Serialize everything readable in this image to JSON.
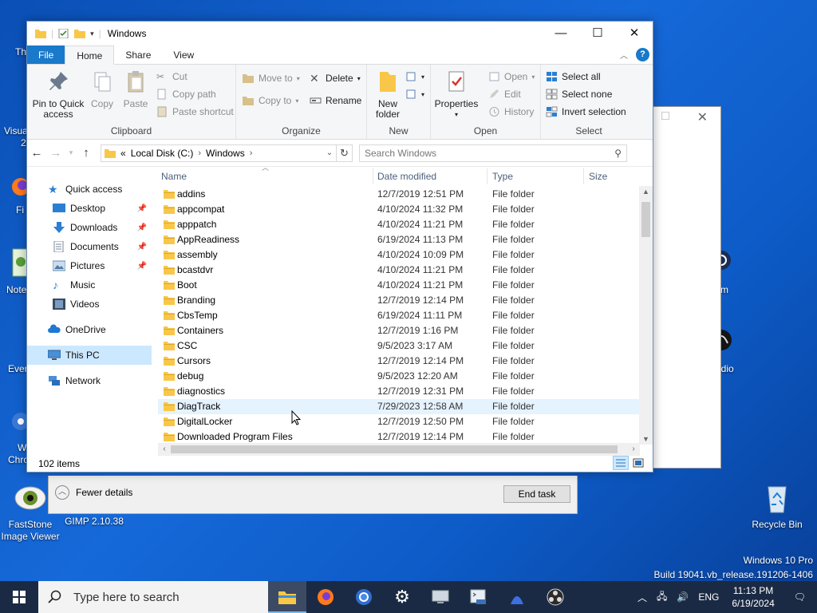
{
  "explorer": {
    "title": "Windows",
    "window_buttons": {
      "minimize": "—",
      "maximize": "☐",
      "close": "✕"
    },
    "tabs": [
      {
        "label": "File"
      },
      {
        "label": "Home"
      },
      {
        "label": "Share"
      },
      {
        "label": "View"
      }
    ],
    "ribbon": {
      "clipboard": {
        "group_label": "Clipboard",
        "pin": "Pin to Quick access",
        "copy": "Copy",
        "paste": "Paste",
        "cut": "Cut",
        "copy_path": "Copy path",
        "paste_shortcut": "Paste shortcut"
      },
      "organize": {
        "group_label": "Organize",
        "move_to": "Move to",
        "copy_to": "Copy to",
        "delete": "Delete",
        "rename": "Rename"
      },
      "new": {
        "group_label": "New",
        "new_folder": "New folder"
      },
      "open": {
        "group_label": "Open",
        "properties": "Properties",
        "open": "Open",
        "edit": "Edit",
        "history": "History"
      },
      "select": {
        "group_label": "Select",
        "select_all": "Select all",
        "select_none": "Select none",
        "invert": "Invert selection"
      }
    },
    "address": {
      "prefix": "«",
      "crumbs": [
        "Local Disk (C:)",
        "Windows"
      ],
      "search_placeholder": "Search Windows"
    },
    "nav": {
      "quick_access": "Quick access",
      "desktop": "Desktop",
      "downloads": "Downloads",
      "documents": "Documents",
      "pictures": "Pictures",
      "music": "Music",
      "videos": "Videos",
      "onedrive": "OneDrive",
      "this_pc": "This PC",
      "network": "Network"
    },
    "columns": {
      "name": "Name",
      "date": "Date modified",
      "type": "Type",
      "size": "Size"
    },
    "files": [
      {
        "name": "addins",
        "date": "12/7/2019 12:51 PM",
        "type": "File folder"
      },
      {
        "name": "appcompat",
        "date": "4/10/2024 11:32 PM",
        "type": "File folder"
      },
      {
        "name": "apppatch",
        "date": "4/10/2024 11:21 PM",
        "type": "File folder"
      },
      {
        "name": "AppReadiness",
        "date": "6/19/2024 11:13 PM",
        "type": "File folder"
      },
      {
        "name": "assembly",
        "date": "4/10/2024 10:09 PM",
        "type": "File folder"
      },
      {
        "name": "bcastdvr",
        "date": "4/10/2024 11:21 PM",
        "type": "File folder"
      },
      {
        "name": "Boot",
        "date": "4/10/2024 11:21 PM",
        "type": "File folder"
      },
      {
        "name": "Branding",
        "date": "12/7/2019 12:14 PM",
        "type": "File folder"
      },
      {
        "name": "CbsTemp",
        "date": "6/19/2024 11:11 PM",
        "type": "File folder"
      },
      {
        "name": "Containers",
        "date": "12/7/2019 1:16 PM",
        "type": "File folder"
      },
      {
        "name": "CSC",
        "date": "9/5/2023 3:17 AM",
        "type": "File folder"
      },
      {
        "name": "Cursors",
        "date": "12/7/2019 12:14 PM",
        "type": "File folder"
      },
      {
        "name": "debug",
        "date": "9/5/2023 12:20 AM",
        "type": "File folder"
      },
      {
        "name": "diagnostics",
        "date": "12/7/2019 12:31 PM",
        "type": "File folder"
      },
      {
        "name": "DiagTrack",
        "date": "7/29/2023 12:58 AM",
        "type": "File folder"
      },
      {
        "name": "DigitalLocker",
        "date": "12/7/2019 12:50 PM",
        "type": "File folder"
      },
      {
        "name": "Downloaded Program Files",
        "date": "12/7/2019 12:14 PM",
        "type": "File folder"
      }
    ],
    "status": {
      "item_count": "102 items"
    }
  },
  "task_manager": {
    "fewer_details": "Fewer details",
    "end_task": "End task"
  },
  "desktop": {
    "icons": [
      {
        "label": "FastStone Image Viewer"
      },
      {
        "label": "GIMP 2.10.38"
      },
      {
        "label": "Recycle Bin"
      }
    ],
    "edge_labels": [
      "Th",
      "Visua",
      "2",
      "Fi",
      "Note",
      "Ever",
      "W",
      "Chro",
      "m",
      "udio"
    ]
  },
  "watermark": {
    "line1": "Windows 10 Pro",
    "line2": "Build 19041.vb_release.191206-1406"
  },
  "taskbar": {
    "search_placeholder": "Type here to search",
    "language": "ENG",
    "time": "11:13 PM",
    "date": "6/19/2024"
  },
  "colors": {
    "accent": "#1979ca",
    "taskbar": "#1b2a44",
    "selection": "#cce8ff",
    "folder": "#f8c74a"
  }
}
